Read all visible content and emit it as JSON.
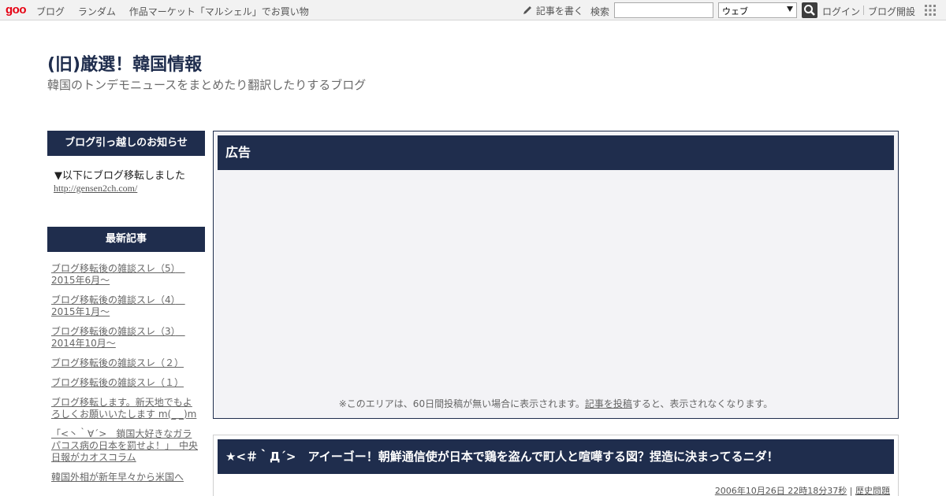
{
  "toolbar": {
    "logo": "goo",
    "nav": [
      "ブログ",
      "ランダム",
      "作品マーケット「マルシェル」でお買い物"
    ],
    "write": "記事を書く",
    "search_label": "検索",
    "search_value": "",
    "select_value": "ウェブ",
    "login": "ログイン",
    "open_blog": "ブログ開設"
  },
  "blog": {
    "title": "(旧)厳選！韓国情報",
    "description": "韓国のトンデモニュースをまとめたり翻訳したりするブログ"
  },
  "sidebar": {
    "notice_heading": "ブログ引っ越しのお知らせ",
    "notice_text": "▼以下にブログ移転しました",
    "notice_link": "http://gensen2ch.com/",
    "recent_heading": "最新記事",
    "recent_items": [
      "ブログ移転後の雑談スレ（5）　2015年6月～",
      "ブログ移転後の雑談スレ（4）　2015年1月～",
      "ブログ移転後の雑談スレ（3）　2014年10月～",
      "ブログ移転後の雑談スレ（２）",
      "ブログ移転後の雑談スレ（１）",
      "ブログ移転します。新天地でもよろしくお願いいたします m(_ _)m",
      "「<丶｀∀´>　鎖国大好きなガラパコス病の日本を罰せよ！」　中央日報がカオスコラム",
      "韓国外相が新年早々から米国へ"
    ]
  },
  "ad": {
    "heading": "広告",
    "note_before": "※このエリアは、60日間投稿が無い場合に表示されます。",
    "note_link": "記事を投稿",
    "note_after": "すると、表示されなくなります。"
  },
  "post": {
    "title": "★<＃｀Д´>　アイーゴー！朝鮮通信使が日本で鶏を盗んで町人と喧嘩する図？捏造に決まってるニダ！",
    "date": "2006年10月26日 22時18分37秒",
    "separator": " | ",
    "category": "歴史問題"
  },
  "colors": {
    "header_navy": "#1f2d4d",
    "logo_red": "#e60012"
  },
  "icons": [
    "pencil-icon",
    "search-icon",
    "chevron-down-icon",
    "grid-menu-icon"
  ]
}
